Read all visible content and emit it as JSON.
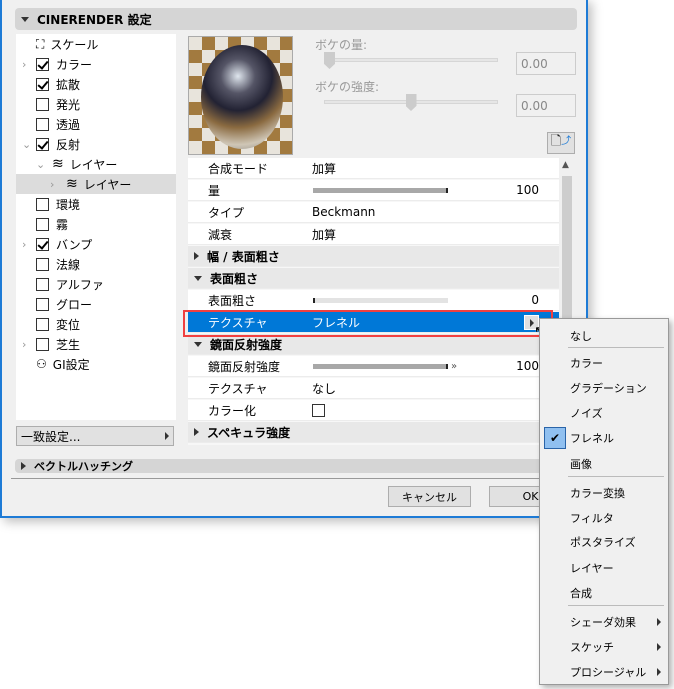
{
  "header": {
    "title": "CINERENDER 設定"
  },
  "tree": [
    {
      "label": "スケール",
      "kind": "scale"
    },
    {
      "label": "カラー",
      "checked": true,
      "chevron": "right"
    },
    {
      "label": "拡散",
      "checked": true
    },
    {
      "label": "発光",
      "checked": false
    },
    {
      "label": "透過",
      "checked": false
    },
    {
      "label": "反射",
      "checked": true,
      "chevron": "down"
    },
    {
      "label": "レイヤー",
      "kind": "layer",
      "chevron": "down"
    },
    {
      "label": "レイヤー",
      "kind": "layer",
      "chevron": "right",
      "selected": true
    },
    {
      "label": "環境",
      "checked": false
    },
    {
      "label": "霧",
      "checked": false
    },
    {
      "label": "バンプ",
      "checked": true,
      "chevron": "right"
    },
    {
      "label": "法線",
      "checked": false
    },
    {
      "label": "アルファ",
      "checked": false
    },
    {
      "label": "グロー",
      "checked": false
    },
    {
      "label": "変位",
      "checked": false
    },
    {
      "label": "芝生",
      "checked": false,
      "chevron": "right"
    },
    {
      "label": "GI設定",
      "kind": "gi"
    }
  ],
  "match_button": "一致設定...",
  "bokeh": {
    "amount_label": "ボケの量:",
    "amount_value": "0.00",
    "amount_slider": 0,
    "strength_label": "ボケの強度:",
    "strength_value": "0.00",
    "strength_slider": 0.5
  },
  "props": {
    "blend_label": "合成モード",
    "blend_value": "加算",
    "amount_label": "量",
    "amount_value": "100",
    "type_label": "タイプ",
    "type_value": "Beckmann",
    "atten_label": "減衰",
    "atten_value": "加算",
    "group_width": "幅 / 表面粗さ",
    "group_rough": "表面粗さ",
    "rough_label": "表面粗さ",
    "rough_value": "0",
    "tex_label": "テクスチャ",
    "tex_value": "フレネル",
    "group_spec": "鏡面反射強度",
    "spec_label": "鏡面反射強度",
    "spec_value": "100",
    "tex2_label": "テクスチャ",
    "tex2_value": "なし",
    "colorize_label": "カラー化",
    "group_specular": "スペキュラ強度"
  },
  "vector_hatching": "ベクトルハッチング",
  "buttons": {
    "cancel": "キャンセル",
    "ok": "OK"
  },
  "menu": {
    "items": [
      "なし",
      "カラー",
      "グラデーション",
      "ノイズ",
      "フレネル",
      "画像",
      "カラー変換",
      "フィルタ",
      "ポスタライズ",
      "レイヤー",
      "合成",
      "シェーダ効果",
      "スケッチ",
      "プロシージャル"
    ],
    "checked": "フレネル"
  },
  "colors": {
    "selection": "#0078d7",
    "highlight_border": "#f04040"
  }
}
